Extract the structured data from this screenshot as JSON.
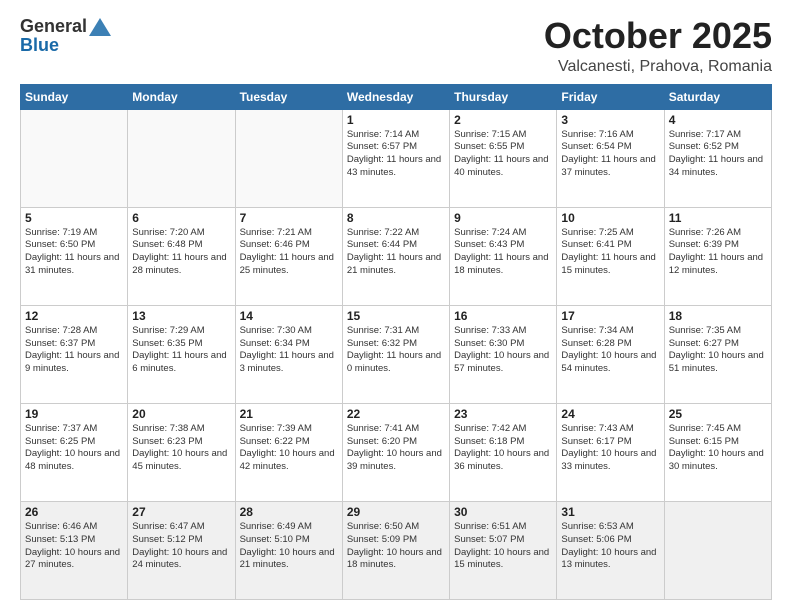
{
  "header": {
    "logo_general": "General",
    "logo_blue": "Blue",
    "month_title": "October 2025",
    "location": "Valcanesti, Prahova, Romania"
  },
  "weekdays": [
    "Sunday",
    "Monday",
    "Tuesday",
    "Wednesday",
    "Thursday",
    "Friday",
    "Saturday"
  ],
  "weeks": [
    [
      {
        "day": "",
        "sunrise": "",
        "sunset": "",
        "daylight": ""
      },
      {
        "day": "",
        "sunrise": "",
        "sunset": "",
        "daylight": ""
      },
      {
        "day": "",
        "sunrise": "",
        "sunset": "",
        "daylight": ""
      },
      {
        "day": "1",
        "sunrise": "Sunrise: 7:14 AM",
        "sunset": "Sunset: 6:57 PM",
        "daylight": "Daylight: 11 hours and 43 minutes."
      },
      {
        "day": "2",
        "sunrise": "Sunrise: 7:15 AM",
        "sunset": "Sunset: 6:55 PM",
        "daylight": "Daylight: 11 hours and 40 minutes."
      },
      {
        "day": "3",
        "sunrise": "Sunrise: 7:16 AM",
        "sunset": "Sunset: 6:54 PM",
        "daylight": "Daylight: 11 hours and 37 minutes."
      },
      {
        "day": "4",
        "sunrise": "Sunrise: 7:17 AM",
        "sunset": "Sunset: 6:52 PM",
        "daylight": "Daylight: 11 hours and 34 minutes."
      }
    ],
    [
      {
        "day": "5",
        "sunrise": "Sunrise: 7:19 AM",
        "sunset": "Sunset: 6:50 PM",
        "daylight": "Daylight: 11 hours and 31 minutes."
      },
      {
        "day": "6",
        "sunrise": "Sunrise: 7:20 AM",
        "sunset": "Sunset: 6:48 PM",
        "daylight": "Daylight: 11 hours and 28 minutes."
      },
      {
        "day": "7",
        "sunrise": "Sunrise: 7:21 AM",
        "sunset": "Sunset: 6:46 PM",
        "daylight": "Daylight: 11 hours and 25 minutes."
      },
      {
        "day": "8",
        "sunrise": "Sunrise: 7:22 AM",
        "sunset": "Sunset: 6:44 PM",
        "daylight": "Daylight: 11 hours and 21 minutes."
      },
      {
        "day": "9",
        "sunrise": "Sunrise: 7:24 AM",
        "sunset": "Sunset: 6:43 PM",
        "daylight": "Daylight: 11 hours and 18 minutes."
      },
      {
        "day": "10",
        "sunrise": "Sunrise: 7:25 AM",
        "sunset": "Sunset: 6:41 PM",
        "daylight": "Daylight: 11 hours and 15 minutes."
      },
      {
        "day": "11",
        "sunrise": "Sunrise: 7:26 AM",
        "sunset": "Sunset: 6:39 PM",
        "daylight": "Daylight: 11 hours and 12 minutes."
      }
    ],
    [
      {
        "day": "12",
        "sunrise": "Sunrise: 7:28 AM",
        "sunset": "Sunset: 6:37 PM",
        "daylight": "Daylight: 11 hours and 9 minutes."
      },
      {
        "day": "13",
        "sunrise": "Sunrise: 7:29 AM",
        "sunset": "Sunset: 6:35 PM",
        "daylight": "Daylight: 11 hours and 6 minutes."
      },
      {
        "day": "14",
        "sunrise": "Sunrise: 7:30 AM",
        "sunset": "Sunset: 6:34 PM",
        "daylight": "Daylight: 11 hours and 3 minutes."
      },
      {
        "day": "15",
        "sunrise": "Sunrise: 7:31 AM",
        "sunset": "Sunset: 6:32 PM",
        "daylight": "Daylight: 11 hours and 0 minutes."
      },
      {
        "day": "16",
        "sunrise": "Sunrise: 7:33 AM",
        "sunset": "Sunset: 6:30 PM",
        "daylight": "Daylight: 10 hours and 57 minutes."
      },
      {
        "day": "17",
        "sunrise": "Sunrise: 7:34 AM",
        "sunset": "Sunset: 6:28 PM",
        "daylight": "Daylight: 10 hours and 54 minutes."
      },
      {
        "day": "18",
        "sunrise": "Sunrise: 7:35 AM",
        "sunset": "Sunset: 6:27 PM",
        "daylight": "Daylight: 10 hours and 51 minutes."
      }
    ],
    [
      {
        "day": "19",
        "sunrise": "Sunrise: 7:37 AM",
        "sunset": "Sunset: 6:25 PM",
        "daylight": "Daylight: 10 hours and 48 minutes."
      },
      {
        "day": "20",
        "sunrise": "Sunrise: 7:38 AM",
        "sunset": "Sunset: 6:23 PM",
        "daylight": "Daylight: 10 hours and 45 minutes."
      },
      {
        "day": "21",
        "sunrise": "Sunrise: 7:39 AM",
        "sunset": "Sunset: 6:22 PM",
        "daylight": "Daylight: 10 hours and 42 minutes."
      },
      {
        "day": "22",
        "sunrise": "Sunrise: 7:41 AM",
        "sunset": "Sunset: 6:20 PM",
        "daylight": "Daylight: 10 hours and 39 minutes."
      },
      {
        "day": "23",
        "sunrise": "Sunrise: 7:42 AM",
        "sunset": "Sunset: 6:18 PM",
        "daylight": "Daylight: 10 hours and 36 minutes."
      },
      {
        "day": "24",
        "sunrise": "Sunrise: 7:43 AM",
        "sunset": "Sunset: 6:17 PM",
        "daylight": "Daylight: 10 hours and 33 minutes."
      },
      {
        "day": "25",
        "sunrise": "Sunrise: 7:45 AM",
        "sunset": "Sunset: 6:15 PM",
        "daylight": "Daylight: 10 hours and 30 minutes."
      }
    ],
    [
      {
        "day": "26",
        "sunrise": "Sunrise: 6:46 AM",
        "sunset": "Sunset: 5:13 PM",
        "daylight": "Daylight: 10 hours and 27 minutes."
      },
      {
        "day": "27",
        "sunrise": "Sunrise: 6:47 AM",
        "sunset": "Sunset: 5:12 PM",
        "daylight": "Daylight: 10 hours and 24 minutes."
      },
      {
        "day": "28",
        "sunrise": "Sunrise: 6:49 AM",
        "sunset": "Sunset: 5:10 PM",
        "daylight": "Daylight: 10 hours and 21 minutes."
      },
      {
        "day": "29",
        "sunrise": "Sunrise: 6:50 AM",
        "sunset": "Sunset: 5:09 PM",
        "daylight": "Daylight: 10 hours and 18 minutes."
      },
      {
        "day": "30",
        "sunrise": "Sunrise: 6:51 AM",
        "sunset": "Sunset: 5:07 PM",
        "daylight": "Daylight: 10 hours and 15 minutes."
      },
      {
        "day": "31",
        "sunrise": "Sunrise: 6:53 AM",
        "sunset": "Sunset: 5:06 PM",
        "daylight": "Daylight: 10 hours and 13 minutes."
      },
      {
        "day": "",
        "sunrise": "",
        "sunset": "",
        "daylight": ""
      }
    ]
  ]
}
